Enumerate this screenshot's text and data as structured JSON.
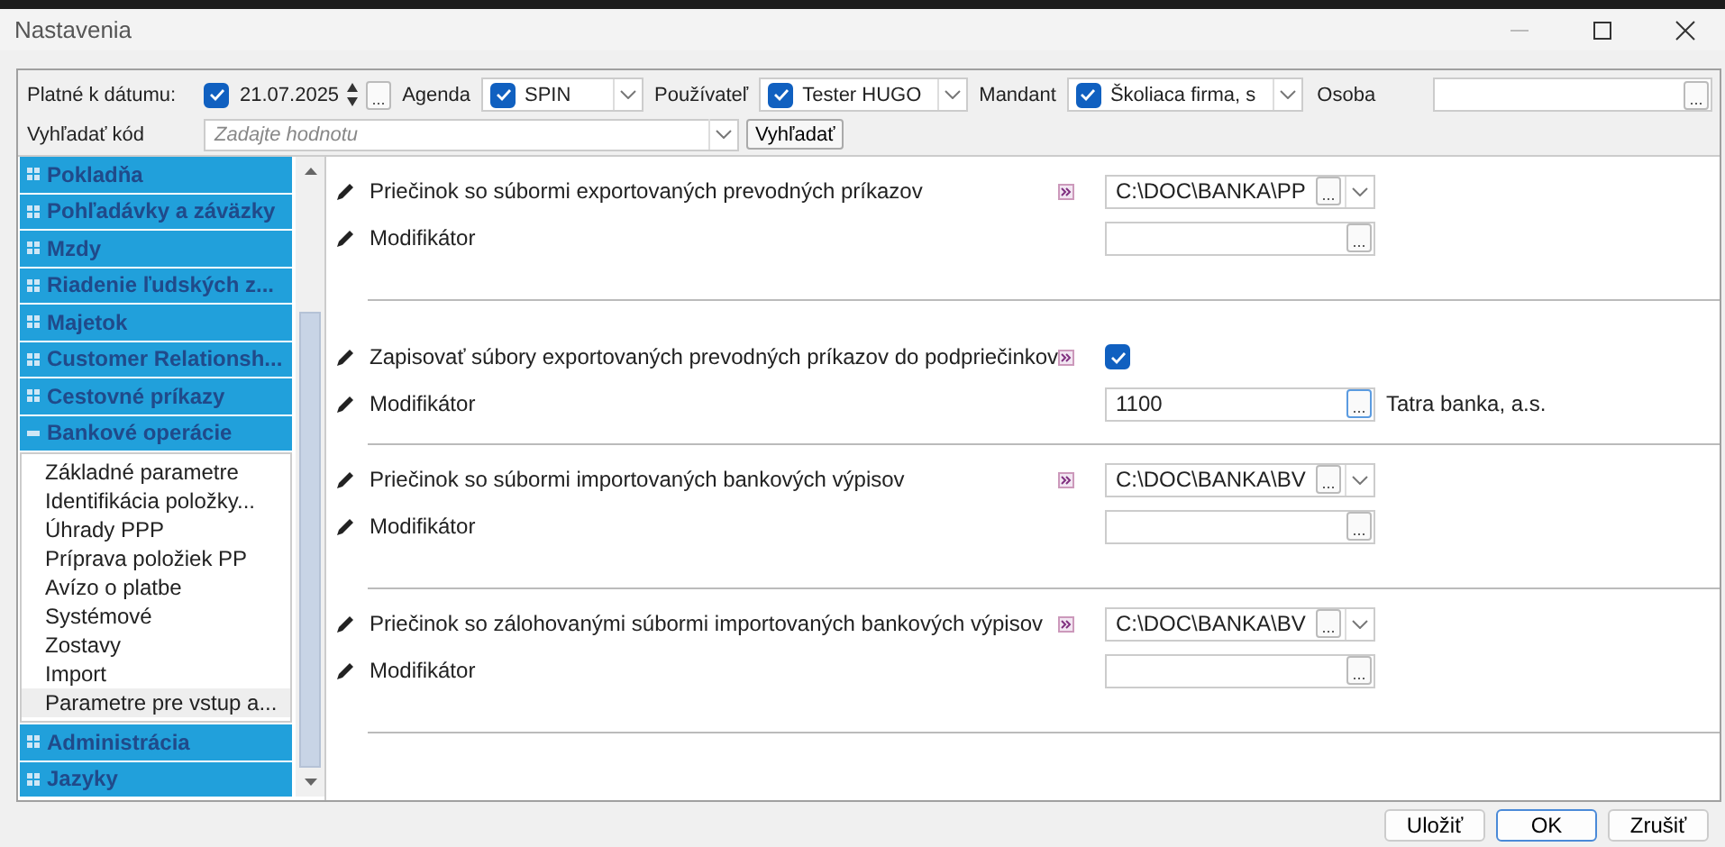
{
  "window": {
    "title": "Nastavenia"
  },
  "filters": [
    {
      "kind": "date",
      "label": "Platné k dátumu:",
      "checked": true,
      "value": "21.07.2025",
      "browse": "..."
    },
    {
      "kind": "combo",
      "label": "Agenda",
      "checked": true,
      "value": "SPIN"
    },
    {
      "kind": "combo",
      "label": "Používateľ",
      "checked": true,
      "value": "Tester HUGO"
    },
    {
      "kind": "combo",
      "label": "Mandant",
      "checked": true,
      "value": "Školiaca firma, s"
    },
    {
      "kind": "field",
      "label": "Osoba",
      "browse": "..."
    }
  ],
  "search": {
    "label": "Vyhľadať kód",
    "placeholder": "Zadajte hodnotu",
    "button": "Vyhľadať"
  },
  "nav": [
    {
      "label": "Pokladňa",
      "expanded": false
    },
    {
      "label": "Pohľadávky a záväzky",
      "expanded": false
    },
    {
      "label": "Mzdy",
      "expanded": false
    },
    {
      "label": "Riadenie ľudských z...",
      "expanded": false
    },
    {
      "label": "Majetok",
      "expanded": false
    },
    {
      "label": "Customer Relationsh...",
      "expanded": false
    },
    {
      "label": "Cestovné príkazy",
      "expanded": false
    },
    {
      "label": "Bankové operácie",
      "expanded": true,
      "children": [
        {
          "label": "Základné parametre",
          "selected": false
        },
        {
          "label": "Identifikácia  položky...",
          "selected": false
        },
        {
          "label": "Úhrady PPP",
          "selected": false
        },
        {
          "label": "Príprava položiek PP",
          "selected": false
        },
        {
          "label": "Avízo o platbe",
          "selected": false
        },
        {
          "label": "Systémové",
          "selected": false
        },
        {
          "label": "Zostavy",
          "selected": false
        },
        {
          "label": "Import",
          "selected": false
        },
        {
          "label": "Parametre pre vstup a...",
          "selected": true
        }
      ]
    },
    {
      "label": "Administrácia",
      "expanded": false
    },
    {
      "label": "Jazyky",
      "expanded": false
    }
  ],
  "sections": [
    {
      "kind": "path",
      "label": "Priečinok so súbormi exportovaných prevodných príkazov",
      "value": "C:\\DOC\\BANKA\\PP",
      "browse": "...",
      "modifier": {
        "label": "Modifikátor",
        "browse": "..."
      }
    },
    {
      "kind": "checkbox",
      "label": "Zapisovať súbory exportovaných prevodných príkazov do podpriečinkov",
      "checked": true,
      "modifier": {
        "label": "Modifikátor",
        "value": "1100",
        "browse": "...",
        "note": "Tatra banka, a.s."
      }
    },
    {
      "kind": "path",
      "label": "Priečinok so súbormi importovaných bankových výpisov",
      "value": "C:\\DOC\\BANKA\\BV",
      "browse": "...",
      "modifier": {
        "label": "Modifikátor",
        "browse": "..."
      }
    },
    {
      "kind": "path",
      "label": "Priečinok so zálohovanými súbormi importovaných bankových výpisov",
      "value": "C:\\DOC\\BANKA\\BV",
      "browse": "...",
      "modifier": {
        "label": "Modifikátor",
        "browse": "..."
      }
    }
  ],
  "buttons": [
    {
      "label": "Uložiť",
      "default": false
    },
    {
      "label": "OK",
      "default": true
    },
    {
      "label": "Zrušiť",
      "default": false
    }
  ]
}
